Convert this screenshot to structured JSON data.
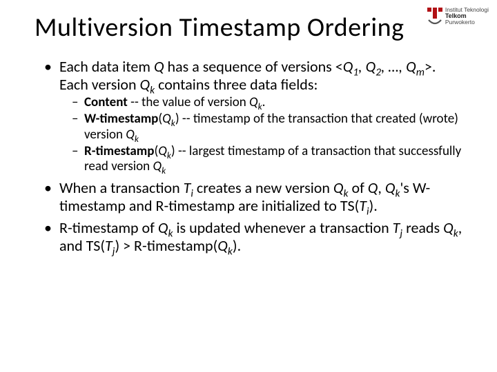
{
  "logo": {
    "top_line": "Institut Teknologi",
    "brand": "Telkom",
    "bottom_line": "Purwokerto"
  },
  "title": "Multiversion Timestamp Ordering",
  "b1": {
    "p1": "Each data item ",
    "q": "Q",
    "p2": " has a sequence of versions <",
    "q1": "Q",
    "s1": "1",
    "c1": ", ",
    "q2": "Q",
    "s2": "2",
    "c2": ", …, ",
    "qm": "Q",
    "sm": "m",
    "p3": ">. Each version ",
    "qk": "Q",
    "sk": "k",
    "p4": " contains three data fields:"
  },
  "sub1": {
    "label": "Content",
    "t1": " -- the value of version ",
    "qk": "Q",
    "sk": "k",
    "t2": "."
  },
  "sub2": {
    "label": "W-timestamp",
    "t1": "(",
    "qk": "Q",
    "sk": "k",
    "t2": ") -- timestamp of the transaction that created (wrote) version ",
    "qk2": "Q",
    "sk2": "k"
  },
  "sub3": {
    "label": "R-timestamp",
    "t1": "(",
    "qk": "Q",
    "sk": "k",
    "t2": ") -- largest timestamp of a transaction that successfully read version ",
    "qk2": "Q",
    "sk2": "k"
  },
  "b2": {
    "p1": "When a transaction ",
    "ti": "T",
    "si": "i",
    "p2": " creates a new version ",
    "qk": "Q",
    "sk": "k",
    "p3": " of ",
    "q": "Q",
    "p4": ", ",
    "qk2": "Q",
    "sk2": "k",
    "p5": "'s W-timestamp and R-timestamp are initialized to TS(",
    "ti2": "T",
    "si2": "i",
    "p6": ")."
  },
  "b3": {
    "p1": "R-timestamp of ",
    "qk": "Q",
    "sk": "k",
    "p2": " is updated whenever a transaction ",
    "tj": "T",
    "sj": "j",
    "p3": " reads ",
    "qk2": "Q",
    "sk2": "k",
    "p4": ", and TS(",
    "tj2": "T",
    "sj2": "j",
    "p5": ") > R-timestamp(",
    "qk3": "Q",
    "sk3": "k",
    "p6": ")."
  }
}
